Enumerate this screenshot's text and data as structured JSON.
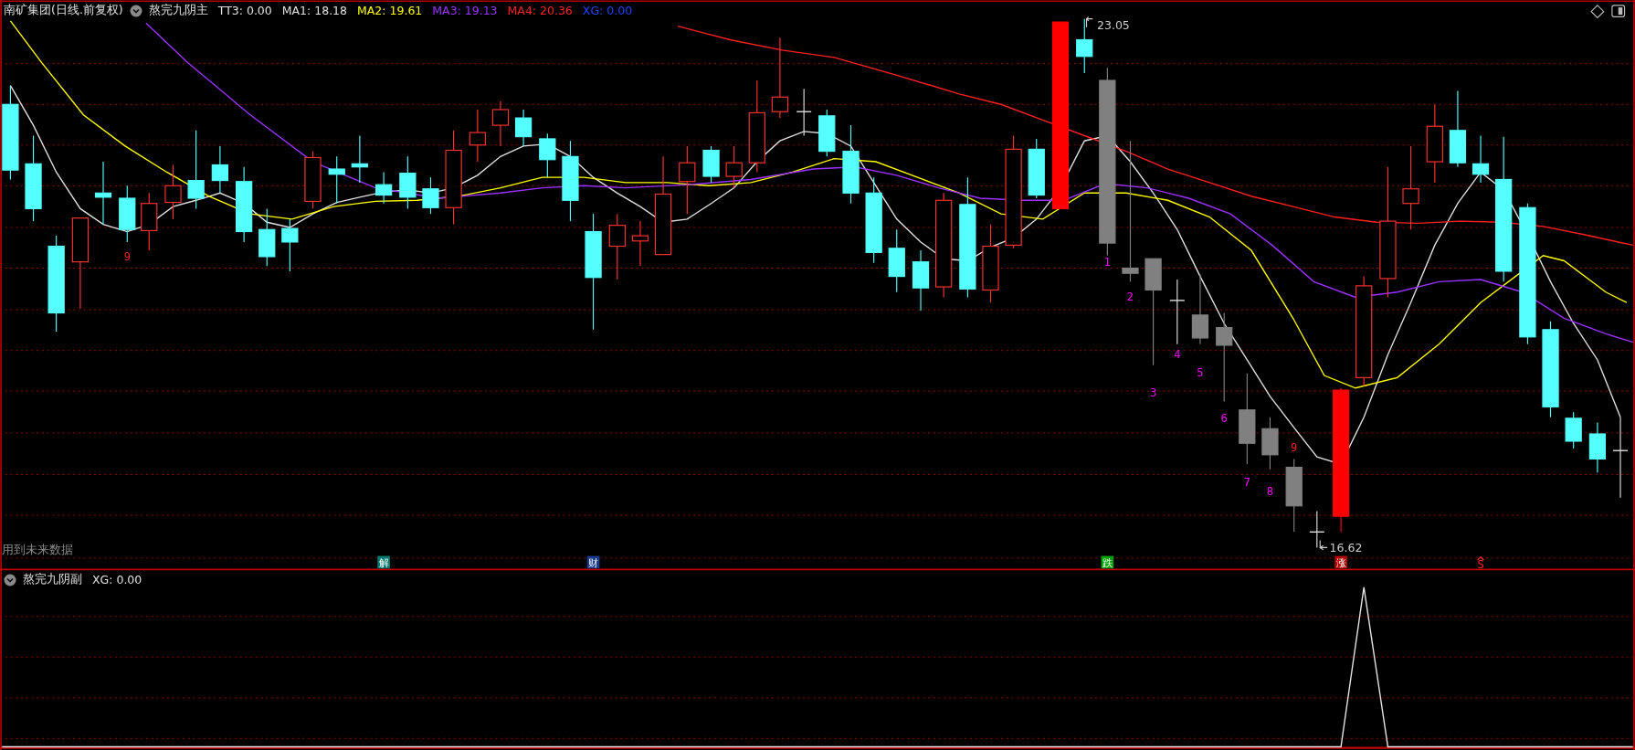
{
  "main_panel": {
    "security": "南矿集团(日线.前复权)",
    "indicator": "熬完九阴主",
    "values": [
      {
        "label": "TT3: 0.00",
        "color": "#e0e0e0"
      },
      {
        "label": "MA1: 18.18",
        "color": "#e0e0e0"
      },
      {
        "label": "MA2: 19.61",
        "color": "#ffff00"
      },
      {
        "label": "MA3: 19.13",
        "color": "#9933ff"
      },
      {
        "label": "MA4: 20.36",
        "color": "#ff2020"
      },
      {
        "label": "XG: 0.00",
        "color": "#2040ff"
      }
    ],
    "high_price": "23.05",
    "low_price": "16.62",
    "counts": [
      {
        "label": "9",
        "color": "#ff2020"
      },
      {
        "label": "1",
        "color": "#ff00ff"
      },
      {
        "label": "2",
        "color": "#ff00ff"
      },
      {
        "label": "3",
        "color": "#ff00ff"
      },
      {
        "label": "4",
        "color": "#ff00ff"
      },
      {
        "label": "5",
        "color": "#ff00ff"
      },
      {
        "label": "6",
        "color": "#ff00ff"
      },
      {
        "label": "7",
        "color": "#ff00ff"
      },
      {
        "label": "8",
        "color": "#ff00ff"
      },
      {
        "label": "9",
        "color": "#ff2020"
      }
    ],
    "warning": "用到未来数据",
    "signals": [
      {
        "label": "解",
        "kind": "badge",
        "color": "#007a6e"
      },
      {
        "label": "财",
        "kind": "badge",
        "color": "#1a3a8a"
      },
      {
        "label": "跌",
        "kind": "badge",
        "color": "#00a000"
      },
      {
        "label": "涨",
        "kind": "badge",
        "color": "#b00000"
      },
      {
        "label": "S",
        "kind": "arrow",
        "color": "#ff2020"
      }
    ]
  },
  "sub_panel": {
    "indicator": "熬完九阴副",
    "values": [
      {
        "label": "XG: 0.00",
        "color": "#e0e0e0"
      }
    ]
  }
}
